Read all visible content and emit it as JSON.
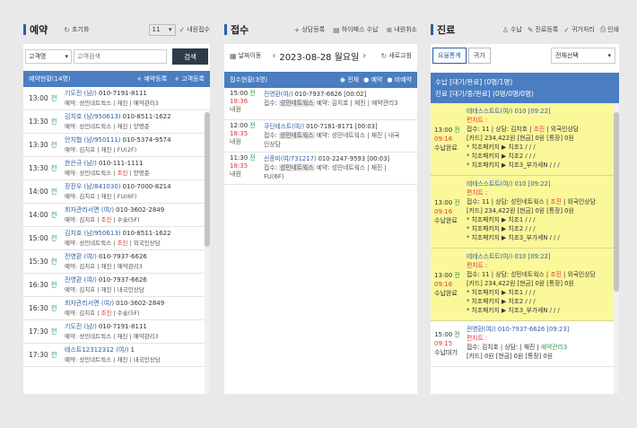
{
  "colors": {
    "accent": "#2b5fa8",
    "header_bar": "#4a7dc1",
    "yellow": "#fbf89a",
    "green": "#2a9a4a",
    "red": "#e03a3a"
  },
  "left": {
    "title": "예약",
    "reset": "초기화",
    "count_value": "11",
    "my_reception": "내원접수",
    "search_select": "고객명",
    "search_placeholder": "고객검색",
    "search_btn": "검색",
    "list_title": "예약현황(14명)",
    "add_reservation": "+ 예약등록",
    "add_customer": "+ 고객등록",
    "rows": [
      {
        "time": "13:00",
        "s": "전",
        "name": "기도진 (남/)",
        "phone": "010-7191-8111",
        "d1": "예약: 성민네트윅스",
        "d2": "재진",
        "d3": "예약관리3",
        "r2": false
      },
      {
        "time": "13:30",
        "s": "전",
        "name": "김치호 (남/950613)",
        "phone": "010-8511-1622",
        "d1": "예약: 성민네트윅스",
        "d2": "재진",
        "d3": "양명준",
        "r2": false
      },
      {
        "time": "13:30",
        "s": "전",
        "name": "안치협 (남/950111)",
        "phone": "010-5374-9574",
        "d1": "예약: 김치호",
        "d2": "재진",
        "d3": "FU(2F)",
        "r2": false
      },
      {
        "time": "13:30",
        "s": "전",
        "name": "한은규 (남/)",
        "phone": "010-111-1111",
        "d1": "예약: 성민네트윅스",
        "d2": "조진",
        "d3": "양명준",
        "r2": true
      },
      {
        "time": "14:00",
        "s": "전",
        "name": "장진우 (남/841030)",
        "phone": "010-7000-8214",
        "d1": "예약: 김치호",
        "d2": "재진",
        "d3": "FU(6F)",
        "r2": false
      },
      {
        "time": "14:00",
        "s": "전",
        "name": "회자관리서면 (여/)",
        "phone": "010-3602-2849",
        "d1": "예약: 김치호",
        "d2": "조진",
        "d3": "수술(5F)",
        "r2": true
      },
      {
        "time": "15:00",
        "s": "전",
        "name": "김치호 (남/950613)",
        "phone": "010-8511-1622",
        "d1": "예약: 성민네트윅스",
        "d2": "조진",
        "d3": "외국인상담",
        "r2": true
      },
      {
        "time": "15:30",
        "s": "전",
        "name": "전영환 (여/)",
        "phone": "010-7937-6626",
        "d1": "예약: 김치호",
        "d2": "재진",
        "d3": "예약관리3",
        "r2": false
      },
      {
        "time": "16:30",
        "s": "전",
        "name": "전영환 (여/)",
        "phone": "010-7937-6626",
        "d1": "예약: 김치호",
        "d2": "재진",
        "d3": "내국인상담",
        "r2": false
      },
      {
        "time": "16:30",
        "s": "전",
        "name": "회자관리서면 (여/)",
        "phone": "010-3602-2849",
        "d1": "예약: 김치호",
        "d2": "조진",
        "d3": "수술(5F)",
        "r2": true
      },
      {
        "time": "17:30",
        "s": "전",
        "name": "기도진 (남/)",
        "phone": "010-7191-8111",
        "d1": "예약: 성민네트윅스",
        "d2": "재진",
        "d3": "예약관리3",
        "r2": false
      },
      {
        "time": "17:30",
        "s": "전",
        "name": "테스트12312312 (여/)",
        "phone": "1",
        "d1": "예약: 성민네트윅스",
        "d2": "재진",
        "d3": "내국인상담",
        "r2": false
      }
    ]
  },
  "mid": {
    "title": "접수",
    "consult": "상담등록",
    "hifi": "하이패스 수납",
    "cancel": "내원취소",
    "date_label": "날짜이동",
    "date": "2023-08-28 월요일",
    "refresh": "새로고침",
    "list_title": "접수현황(3명)",
    "f_all": "전체",
    "f_res": "예약",
    "f_nores": "비예약",
    "rows": [
      {
        "t1": "15:00",
        "s": "전",
        "t2": "18:36",
        "st": "내원",
        "name": "전영환(여/)",
        "phone": "010-7937-6626 [00:02]",
        "hl": "성민네트웍스",
        "rest": "예약: 김치호 | 재진 | 예약관리3",
        "wrap": ""
      },
      {
        "t1": "12:00",
        "s": "전",
        "t2": "18:35",
        "st": "내원",
        "name": "쿠딘테스트(여/)",
        "phone": "010-7181-8171 [00:03]",
        "hl": "성민네트웍스",
        "rest": "예약: 성민네트웍스 | 재진 | 내국",
        "wrap": "인상담"
      },
      {
        "t1": "11:30",
        "s": "전",
        "t2": "18:35",
        "st": "내원",
        "name": "신종미(여/731217)",
        "phone": "010-2247-9593 [00:03]",
        "hl": "성민네트웍스",
        "rest": "예약: 성민네트웍스 | 재진 |",
        "wrap": "FU(6F)"
      }
    ]
  },
  "right": {
    "title": "진료",
    "pay": "수납",
    "treat": "진료등록",
    "home": "귀가처리",
    "print": "인쇄",
    "tab1": "요율통계",
    "tab2": "귀가",
    "select": "전체선택",
    "sum1": "수납 [대기/완료] (0명/1명)",
    "sum2": "진료 [대기/중/완료] (0명/0명/0명)",
    "cards": [
      {
        "t1": "13:00",
        "s": "전",
        "t2": "09:16",
        "st": "수납완료",
        "name": "테테스스트트(여/) 010 [09:22]",
        "note": "편치트 :",
        "rec": "접수: 11 | 상담: 김치호",
        "lab": "조진",
        "ext": "외국인상담",
        "card": "[카드] 234,422원 [현금] 0원 [통장] 0원",
        "items": [
          "* 치조패키지 ▶ 치조1 / / /",
          "* 치조패키지 ▶ 치조2 / / /",
          "* 치조패키지 ▶ 치조3_부가세N / / /"
        ]
      },
      {
        "t1": "13:00",
        "s": "전",
        "t2": "09:16",
        "st": "수납완료",
        "name": "테테스스트트(여/) 010 [09:22]",
        "note": "편치트 :",
        "rec": "접수: 11 | 상담: 성민네트웍스",
        "lab": "조진",
        "ext": "외국인상담",
        "card": "[카드] 234,422원 [현금] 0원 [통장] 0원",
        "items": [
          "* 치조패키지 ▶ 치조1 / / /",
          "* 치조패키지 ▶ 치조2 / / /",
          "* 치조패키지 ▶ 치조3_부가세N / / /"
        ]
      },
      {
        "t1": "13:00",
        "s": "전",
        "t2": "09:16",
        "st": "수납완료",
        "name": "테테스스트트(여/) 010 [09:22]",
        "note": "편치트 :",
        "rec": "접수: 11 | 상담: 성민네트웍스",
        "lab": "조진",
        "ext": "외국인상담",
        "card": "[카드] 234,422원 [현금] 0원 [통장] 0원",
        "items": [
          "* 치조패키지 ▶ 치조1 / / /",
          "* 치조패키지 ▶ 치조2 / / /",
          "* 치조패키지 ▶ 치조3_부가세N / / /"
        ]
      }
    ],
    "last": {
      "t1": "15:00",
      "s": "전",
      "t2": "09:15",
      "st": "수납대기",
      "name": "전영환(여/) 010-7937-6626 [09:23]",
      "note": "편치트 :",
      "rec": "접수: 김치호 | 상담: | 재진 |",
      "ext": "예약관리3",
      "card": "[카드] 0원 [현금] 0원 [통장] 0원"
    }
  }
}
